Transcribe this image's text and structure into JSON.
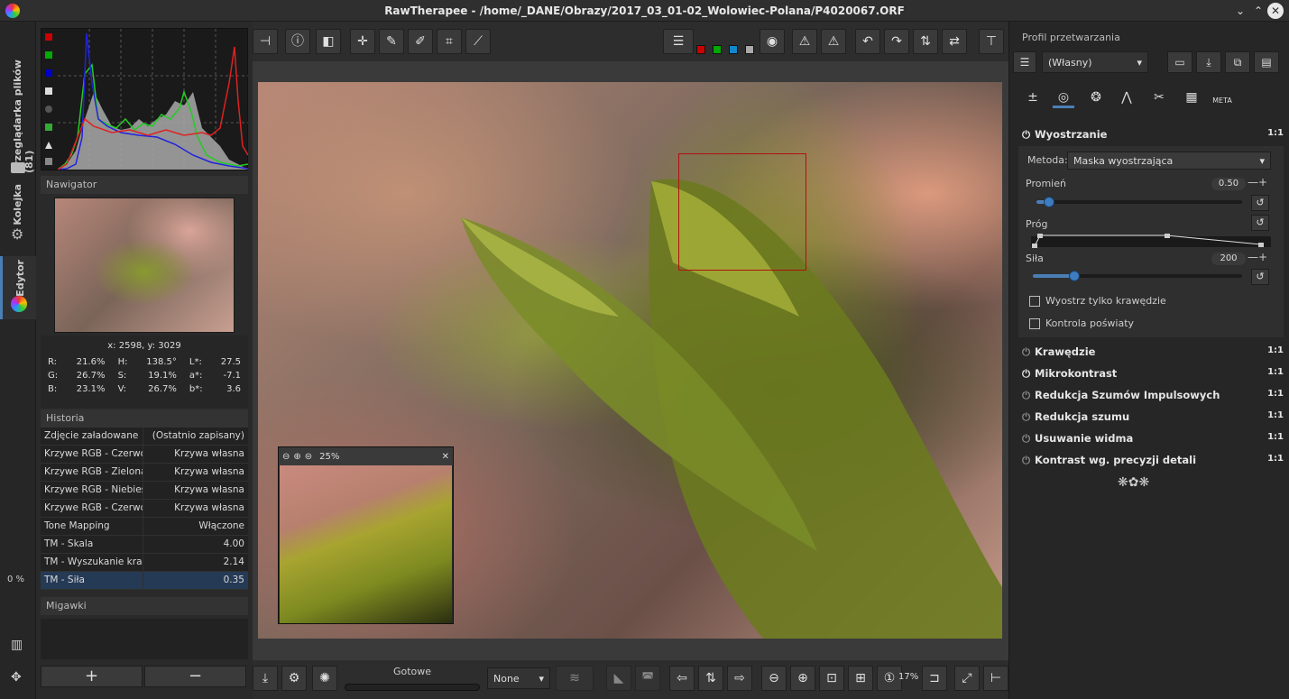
{
  "window": {
    "title": "RawTherapee - /home/_DANE/Obrazy/2017_03_01-02_Wolowiec-Polana/P4020067.ORF"
  },
  "vtabs": {
    "browser": "Przeglądarka plików (81)",
    "queue": "Kolejka",
    "editor": "Edytor",
    "progress": "0 %"
  },
  "navigator": {
    "title": "Nawigator",
    "coords": "x: 2598, y: 3029"
  },
  "pixel_info": {
    "rows": [
      {
        "k1": "R:",
        "v1": "21.6%",
        "k2": "H:",
        "v2": "138.5°",
        "k3": "L*:",
        "v3": "27.5"
      },
      {
        "k1": "G:",
        "v1": "26.7%",
        "k2": "S:",
        "v2": "19.1%",
        "k3": "a*:",
        "v3": "-7.1"
      },
      {
        "k1": "B:",
        "v1": "23.1%",
        "k2": "V:",
        "v2": "26.7%",
        "k3": "b*:",
        "v3": "3.6"
      }
    ]
  },
  "history": {
    "title": "Historia",
    "rows": [
      {
        "action": "Zdjęcie załadowane",
        "value": "(Ostatnio zapisany)"
      },
      {
        "action": "Krzywe RGB - Czerwona",
        "value": "Krzywa własna"
      },
      {
        "action": "Krzywe RGB - Zielona",
        "value": "Krzywa własna"
      },
      {
        "action": "Krzywe RGB - Niebieska",
        "value": "Krzywa własna"
      },
      {
        "action": "Krzywe RGB - Czerwona",
        "value": "Krzywa własna"
      },
      {
        "action": "Tone Mapping",
        "value": "Włączone"
      },
      {
        "action": "TM - Skala",
        "value": "4.00"
      },
      {
        "action": "TM - Wyszukanie kraw…",
        "value": "2.14"
      },
      {
        "action": "TM - Siła",
        "value": "0.35"
      }
    ]
  },
  "snapshots": {
    "title": "Migawki",
    "add": "+",
    "remove": "−"
  },
  "detail_window": {
    "zoom": "25%"
  },
  "bottom": {
    "status": "Gotowe",
    "preset": "None",
    "zoom": "17%"
  },
  "right": {
    "profile_title": "Profil przetwarzania",
    "profile_value": "(Własny)",
    "sharpen": {
      "title": "Wyostrzanie",
      "ratio": "1:1",
      "method_label": "Metoda:",
      "method_value": "Maska wyostrzająca",
      "radius_label": "Promień",
      "radius_value": "0.50",
      "radius_frac": 0.06,
      "threshold_label": "Próg",
      "amount_label": "Siła",
      "amount_value": "200",
      "amount_frac": 0.2,
      "edges_only": "Wyostrz tylko krawędzie",
      "halo": "Kontrola poświaty"
    },
    "sections": [
      {
        "name": "Krawędzie",
        "ratio": "1:1",
        "on": false
      },
      {
        "name": "Mikrokontrast",
        "ratio": "1:1",
        "on": true
      },
      {
        "name": "Redukcja Szumów Impulsowych",
        "ratio": "1:1",
        "on": false
      },
      {
        "name": "Redukcja szumu",
        "ratio": "1:1",
        "on": false
      },
      {
        "name": "Usuwanie widma",
        "ratio": "1:1",
        "on": false
      },
      {
        "name": "Kontrast wg. precyzji detali",
        "ratio": "1:1",
        "on": false
      }
    ],
    "tab_meta": "META"
  },
  "colors": {
    "accent": "#4a7fb5",
    "selection": "#b21010"
  }
}
